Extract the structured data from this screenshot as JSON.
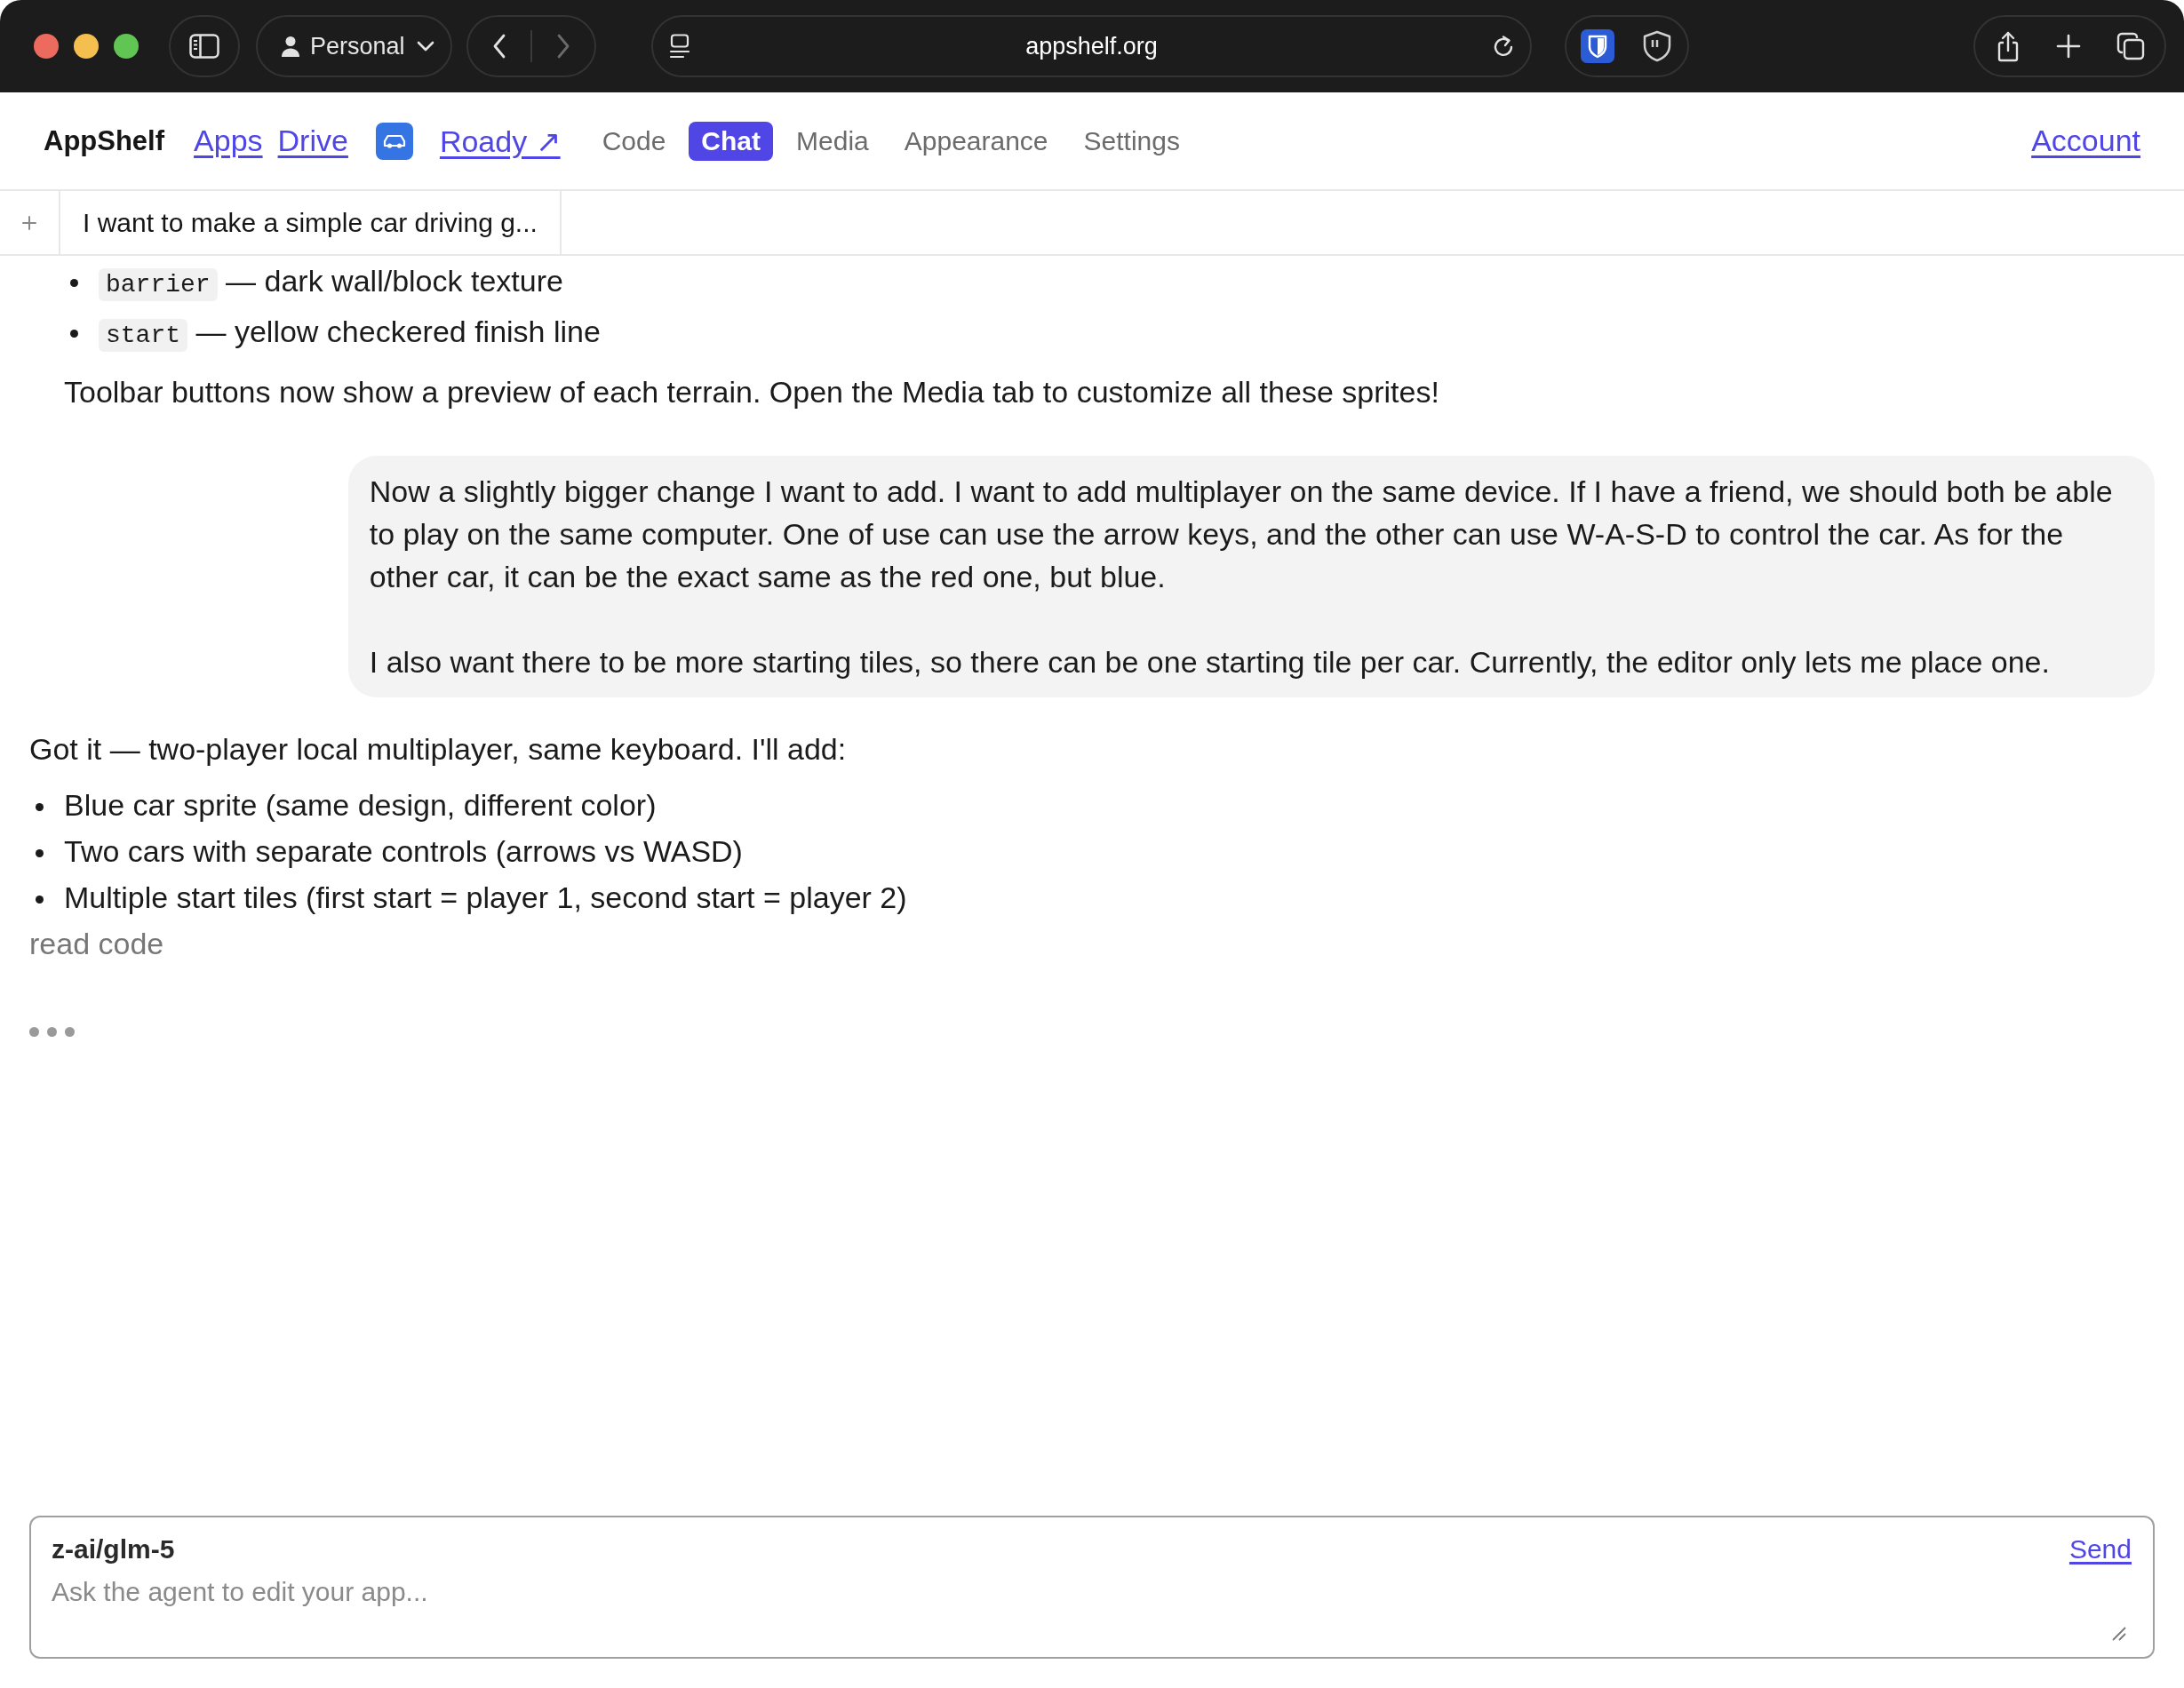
{
  "browser": {
    "profile": "Personal",
    "back_disabled": false,
    "forward_disabled": true,
    "url": "appshelf.org"
  },
  "app_nav": {
    "brand": "AppShelf",
    "links": [
      "Apps",
      "Drive"
    ],
    "project": "Roady ↗",
    "tabs": [
      {
        "label": "Code",
        "selected": false
      },
      {
        "label": "Chat",
        "selected": true
      },
      {
        "label": "Media",
        "selected": false
      },
      {
        "label": "Appearance",
        "selected": false
      },
      {
        "label": "Settings",
        "selected": false
      }
    ],
    "account": "Account"
  },
  "chat_tabs": [
    {
      "title": "I want to make a simple car driving g...",
      "selected": true
    }
  ],
  "messages": [
    {
      "kind": "assistant",
      "blocks": [
        {
          "kind": "nested",
          "blocks": [
            {
              "kind": "list",
              "items": [
                {
                  "code": "barrier",
                  "text": "— dark wall/block texture"
                },
                {
                  "code": "start",
                  "text": "— yellow checkered finish line"
                }
              ]
            },
            {
              "kind": "paragraph",
              "text": "Toolbar buttons now show a preview of each terrain. Open the Media tab to customize all these sprites!"
            }
          ]
        }
      ]
    },
    {
      "kind": "user",
      "paragraphs": [
        "Now a slightly bigger change I want to add. I want to add multiplayer on the same device. If I have a friend, we should both be able to play on the same computer. One of use can use the arrow keys, and the other can use W-A-S-D to control the car. As for the other car, it can be the exact same as the red one, but blue.",
        "I also want there to be more starting tiles, so there can be one starting tile per car. Currently, the editor only lets me place one."
      ]
    },
    {
      "kind": "assistant",
      "blocks": [
        {
          "kind": "paragraph",
          "text": "Got it — two-player local multiplayer, same keyboard. I'll add:"
        },
        {
          "kind": "list",
          "items": [
            {
              "text": "Blue car sprite (same design, different color)"
            },
            {
              "text": "Two cars with separate controls (arrows vs WASD)"
            },
            {
              "text": "Multiple start tiles (first start = player 1, second start = player 2)"
            }
          ]
        },
        {
          "kind": "tool",
          "text": "read code"
        }
      ]
    }
  ],
  "typing": true,
  "composer": {
    "model": "z-ai/glm-5",
    "placeholder": "Ask the agent to edit your app...",
    "send": "Send"
  }
}
